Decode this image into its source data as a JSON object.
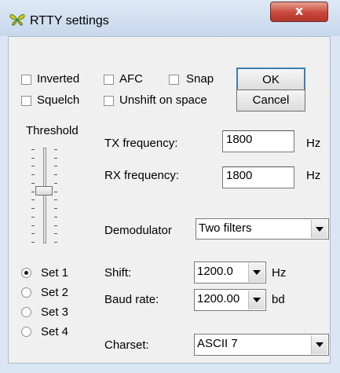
{
  "window": {
    "title": "RTTY settings",
    "close_glyph": "x",
    "app_icon": "butterfly-icon"
  },
  "options": {
    "inverted": "Inverted",
    "afc": "AFC",
    "snap": "Snap",
    "squelch": "Squelch",
    "unshift": "Unshift on space"
  },
  "buttons": {
    "ok": "OK",
    "cancel": "Cancel"
  },
  "threshold": {
    "label": "Threshold",
    "level_fraction": 0.45
  },
  "tx": {
    "label": "TX frequency:",
    "value": "1800",
    "unit": "Hz"
  },
  "rx": {
    "label": "RX frequency:",
    "value": "1800",
    "unit": "Hz"
  },
  "demodulator": {
    "label": "Demodulator",
    "value": "Two filters"
  },
  "sets": [
    {
      "label": "Set 1",
      "selected": true
    },
    {
      "label": "Set 2",
      "selected": false
    },
    {
      "label": "Set 3",
      "selected": false
    },
    {
      "label": "Set 4",
      "selected": false
    }
  ],
  "shift": {
    "label": "Shift:",
    "value": "1200.0",
    "unit": "Hz"
  },
  "baud": {
    "label": "Baud rate:",
    "value": "1200.00",
    "unit": "bd"
  },
  "charset": {
    "label": "Charset:",
    "value": "ASCII 7"
  },
  "colors": {
    "accent": "#3c7fb1",
    "close": "#c9473a"
  }
}
